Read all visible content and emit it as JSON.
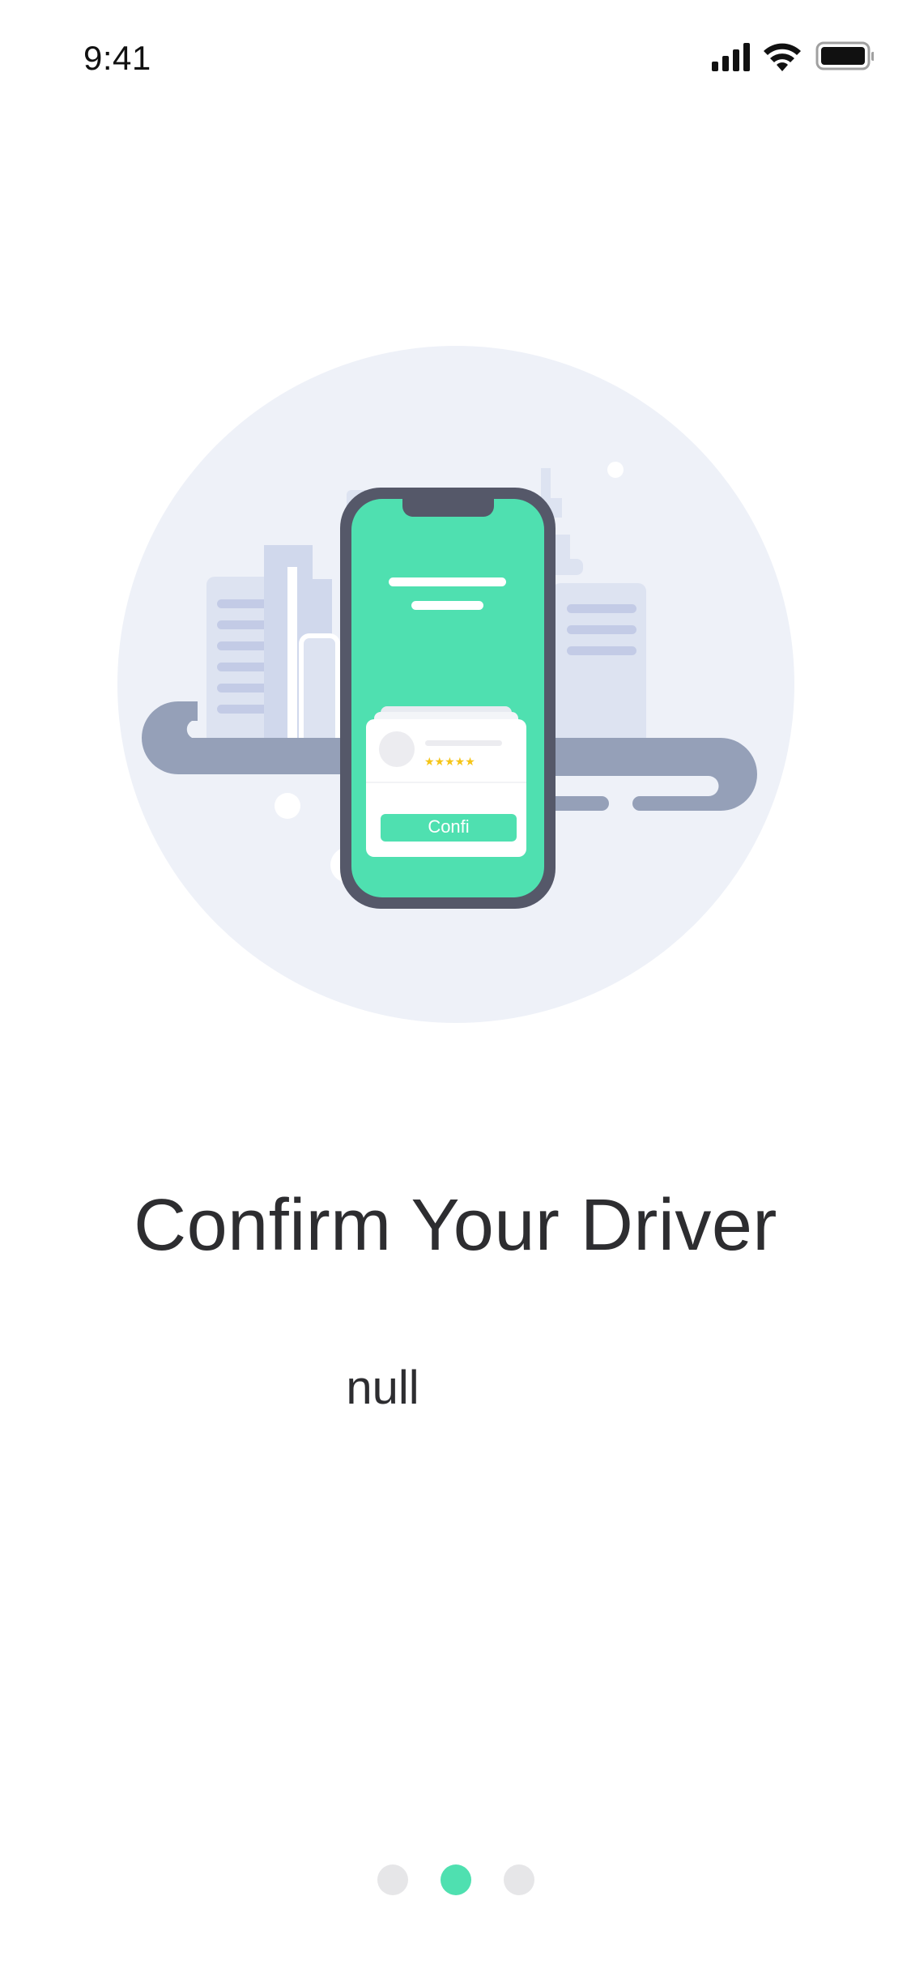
{
  "status_bar": {
    "time": "9:41",
    "icons": [
      "cellular-signal-icon",
      "wifi-icon",
      "battery-icon"
    ]
  },
  "illustration": {
    "phone_button_label": "Confi",
    "rating_stars": 5,
    "accent_color": "#4fe0b0"
  },
  "onboarding": {
    "title": "Confirm Your Driver",
    "description": "null"
  },
  "pager": {
    "total_pages": 3,
    "active_page": 2
  }
}
